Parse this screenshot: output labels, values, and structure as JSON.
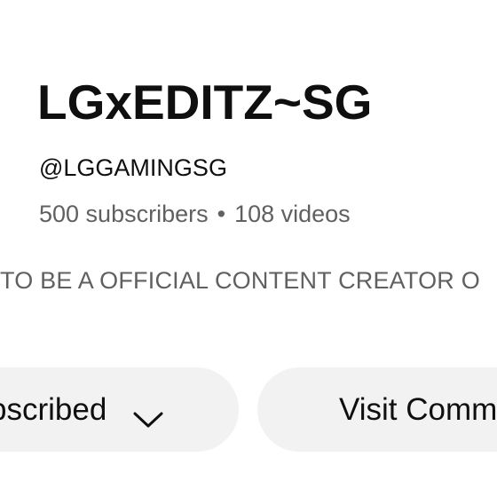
{
  "channel": {
    "name": "LGxEDITZ~SG",
    "handle": "@LGGAMINGSG",
    "subscribers": "500 subscribers",
    "separator": "•",
    "videos": "108 videos",
    "description": "TO BE A OFFICIAL CONTENT CREATOR O"
  },
  "actions": {
    "subscribed_label": "bscribed",
    "visit_community_label": "Visit Comm"
  },
  "icons": {
    "subscribed_dropdown": "chevron-down-icon"
  },
  "colors": {
    "background": "#ffffff",
    "primary_text": "#0f0f0f",
    "secondary_text": "#606060",
    "button_bg": "#f2f2f2"
  }
}
